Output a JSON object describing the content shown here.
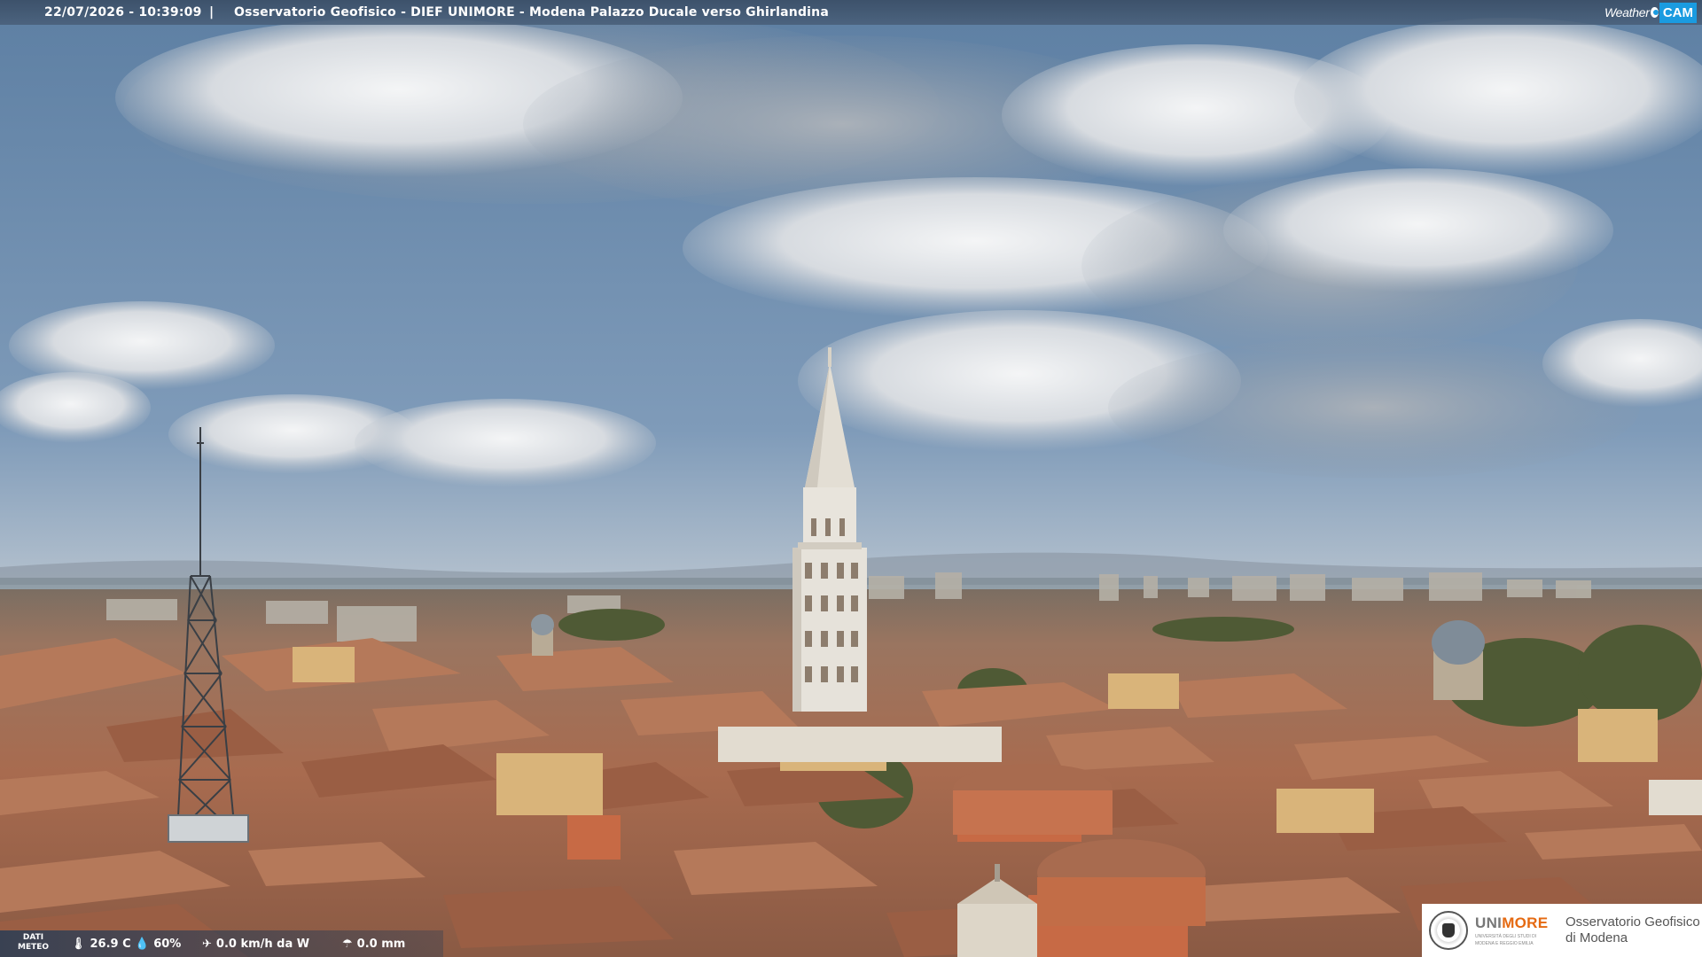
{
  "caption": {
    "timestamp": "22/07/2026 - 10:39:09",
    "separator": "|",
    "title": "Osservatorio Geofisico - DIEF UNIMORE - Modena Palazzo Ducale verso Ghirlandina"
  },
  "brand": {
    "weather": "Weather",
    "cam": "CAM"
  },
  "meteo": {
    "label_line1": "DATI",
    "label_line2": "METEO",
    "temperature": "26.9 C",
    "humidity": "60%",
    "wind": "0.0 km/h da W",
    "rain": "0.0 mm"
  },
  "logo": {
    "uni_part1": "UNI",
    "uni_part2": "MORE",
    "uni_sub1": "UNIVERSITÀ DEGLI STUDI DI",
    "uni_sub2": "MODENA E REGGIO EMILIA",
    "obs_line1": "Osservatorio Geofisico",
    "obs_line2": "di Modena"
  },
  "colors": {
    "sky_top": "#5d7fa3",
    "sky_horizon": "#b7c3cf",
    "roof": "#a86b4f",
    "tower": "#e6e2da",
    "cam_blue": "#1a9be0",
    "unimore_orange": "#e56a12"
  }
}
